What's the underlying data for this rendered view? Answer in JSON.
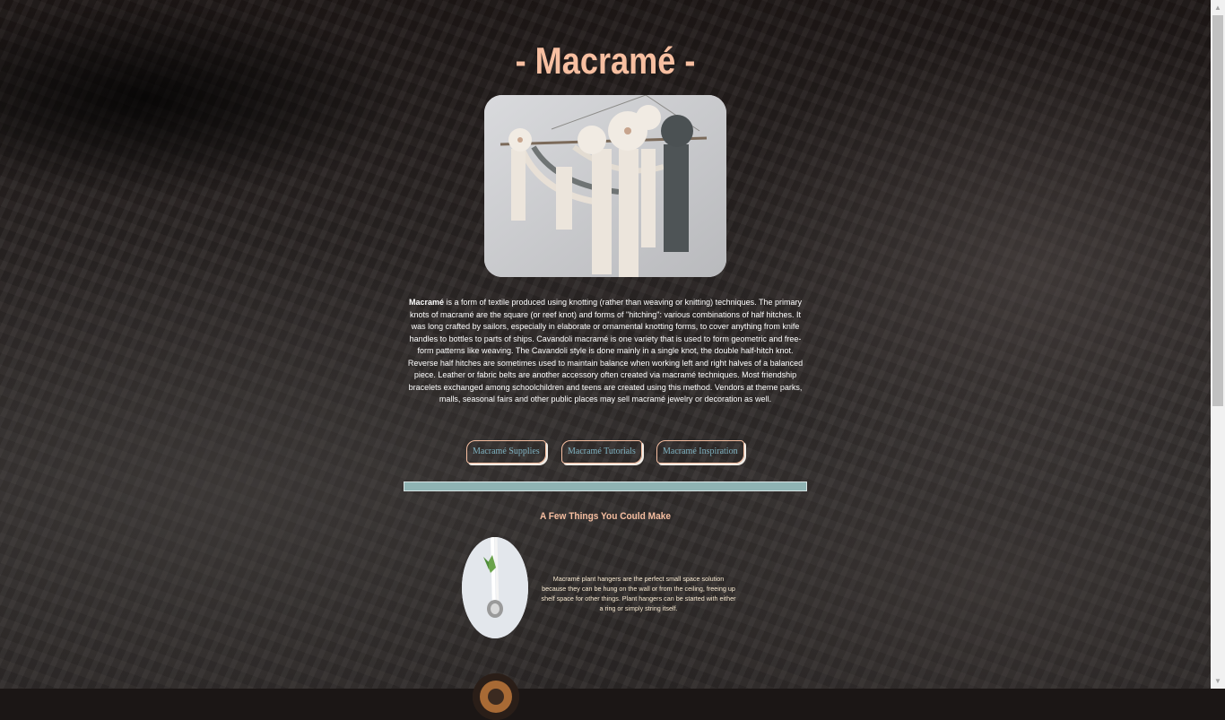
{
  "header": {
    "title": "- Macramé -"
  },
  "intro": {
    "bold_term": "Macramé",
    "text": " is a form of textile produced using knotting (rather than weaving or knitting) techniques. The primary knots of macramé are the square (or reef knot) and forms of \"hitching\": various combinations of half hitches. It was long crafted by sailors, especially in elaborate or ornamental knotting forms, to cover anything from knife handles to bottles to parts of ships. Cavandoli macramé is one variety that is used to form geometric and free-form patterns like weaving. The Cavandoli style is done mainly in a single knot, the double half-hitch knot. Reverse half hitches are sometimes used to maintain balance when working left and right halves of a balanced piece. Leather or fabric belts are another accessory often created via macramé techniques. Most friendship bracelets exchanged among schoolchildren and teens are created using this method. Vendors at theme parks, malls, seasonal fairs and other public places may sell macramé jewelry or decoration as well."
  },
  "nav": {
    "supplies": "Macramé Supplies",
    "tutorials": "Macramé Tutorials",
    "inspiration": "Macramé Inspiration"
  },
  "things": {
    "heading": "A Few Things You Could Make",
    "items": [
      {
        "text": "Macramé plant hangers are the perfect small space solution because they can be hung on the wall or from the ceiling, freeing up shelf space for other things. Plant hangers can be started with either a ring or simply string itself."
      }
    ]
  },
  "colors": {
    "accent": "#f7bfa1",
    "link": "#7fb3c2",
    "divider": "#8fb3b3"
  },
  "icons": {
    "scroll_up": "triangle-up",
    "scroll_down": "triangle-down"
  }
}
